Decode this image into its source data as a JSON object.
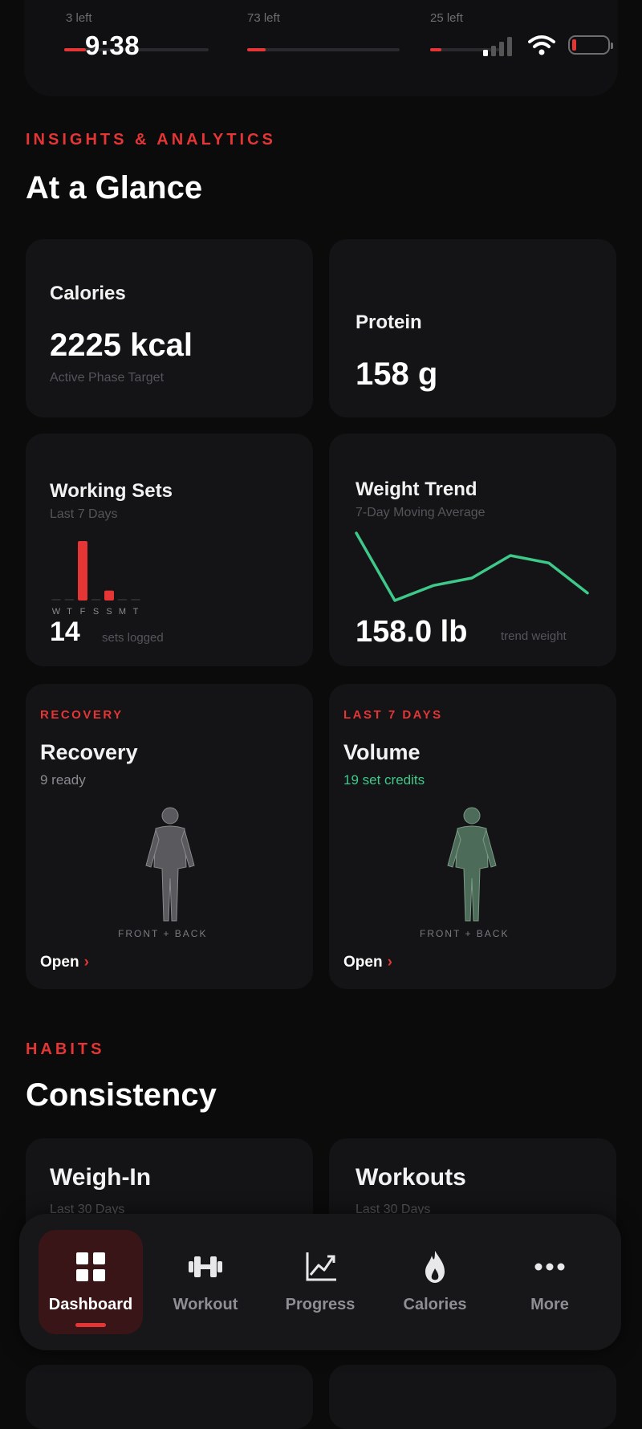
{
  "status_bar": {
    "time": "9:38",
    "tracks": [
      {
        "label": "3 left",
        "progress": 0.15
      },
      {
        "label": "73 left",
        "progress": 0.12
      },
      {
        "label": "25 left",
        "progress": 0.15
      }
    ],
    "icons": [
      "signal-icon",
      "wifi-icon",
      "battery-icon"
    ],
    "battery_level": 0.12
  },
  "insights": {
    "eyebrow": "INSIGHTS & ANALYTICS",
    "title": "At a Glance",
    "calories": {
      "title": "Calories",
      "value": "2225 kcal",
      "subtitle": "Active Phase Target"
    },
    "protein": {
      "title": "Protein",
      "value": "158 g"
    },
    "working_sets": {
      "title": "Working Sets",
      "subtitle": "Last 7 Days",
      "value": "14",
      "note": "sets logged",
      "chart_data": {
        "type": "bar",
        "categories": [
          "W",
          "T",
          "F",
          "S",
          "S",
          "M",
          "T"
        ],
        "values": [
          0,
          0,
          12,
          0,
          2,
          0,
          0
        ]
      }
    },
    "weight_trend": {
      "title": "Weight Trend",
      "subtitle": "7-Day Moving Average",
      "value": "158.0 lb",
      "note": "trend weight",
      "chart_data": {
        "type": "line",
        "values": [
          158.6,
          157.7,
          157.9,
          158.0,
          158.3,
          158.2,
          157.8
        ]
      }
    },
    "recovery": {
      "eyebrow": "RECOVERY",
      "title": "Recovery",
      "subtitle": "9 ready",
      "body_label": "FRONT + BACK",
      "link": "Open",
      "chevron": "›"
    },
    "volume": {
      "eyebrow": "LAST 7 DAYS",
      "title": "Volume",
      "subtitle": "19 set credits",
      "body_label": "FRONT + BACK",
      "link": "Open",
      "chevron": "›"
    }
  },
  "habits": {
    "eyebrow": "HABITS",
    "title": "Consistency",
    "weigh_in": {
      "title": "Weigh-In",
      "subtitle": "Last 30 Days"
    },
    "workouts": {
      "title": "Workouts",
      "subtitle": "Last 30 Days"
    }
  },
  "tabbar": {
    "tabs": [
      {
        "label": "Dashboard",
        "icon": "dashboard-grid-icon",
        "active": true
      },
      {
        "label": "Workout",
        "icon": "dumbbell-icon",
        "active": false
      },
      {
        "label": "Progress",
        "icon": "chart-icon",
        "active": false
      },
      {
        "label": "Calories",
        "icon": "flame-icon",
        "active": false
      },
      {
        "label": "More",
        "icon": "more-dots-icon",
        "active": false
      }
    ]
  },
  "colors": {
    "accent": "#e53535",
    "trend_line": "#3ec98a",
    "card": "#141416",
    "background": "#0b0b0c"
  }
}
